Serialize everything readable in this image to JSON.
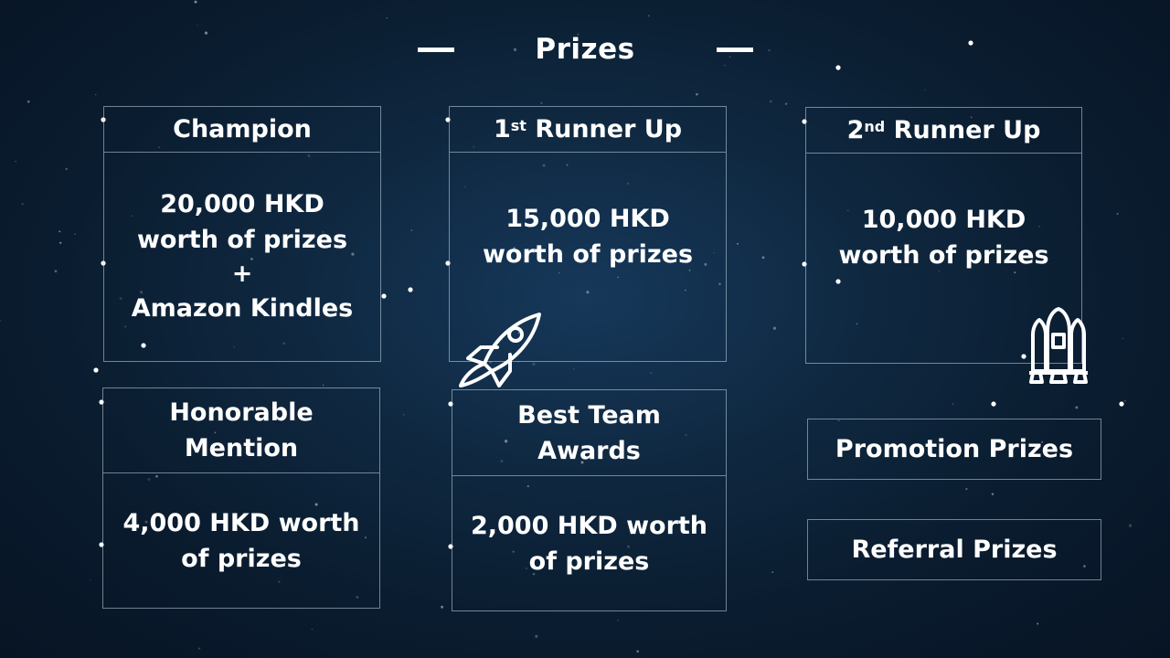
{
  "header": {
    "title": "Prizes"
  },
  "prizes": {
    "champion": {
      "title": "Champion",
      "line1": "20,000 HKD",
      "line2": "worth of prizes",
      "line3": "+",
      "line4": "Amazon Kindles"
    },
    "first_runner_up": {
      "title_num": "1",
      "title_sup": "st",
      "title_rest": "Runner Up",
      "line1": "15,000 HKD",
      "line2": "worth of prizes"
    },
    "second_runner_up": {
      "title_num": "2",
      "title_sup": "nd",
      "title_rest": "Runner Up",
      "line1": "10,000 HKD",
      "line2": "worth of prizes"
    },
    "honorable_mention": {
      "title_line1": "Honorable",
      "title_line2": "Mention",
      "line1": "4,000 HKD worth",
      "line2": "of prizes"
    },
    "best_team": {
      "title_line1": "Best Team",
      "title_line2": "Awards",
      "line1": "2,000 HKD worth",
      "line2": "of prizes"
    },
    "promotion": {
      "label": "Promotion Prizes"
    },
    "referral": {
      "label": "Referral Prizes"
    }
  },
  "icons": {
    "rocket": "rocket-icon",
    "shuttle": "space-shuttle-icon"
  },
  "colors": {
    "background": "#0c2136",
    "text": "#ffffff",
    "border": "#c8d7e6"
  }
}
